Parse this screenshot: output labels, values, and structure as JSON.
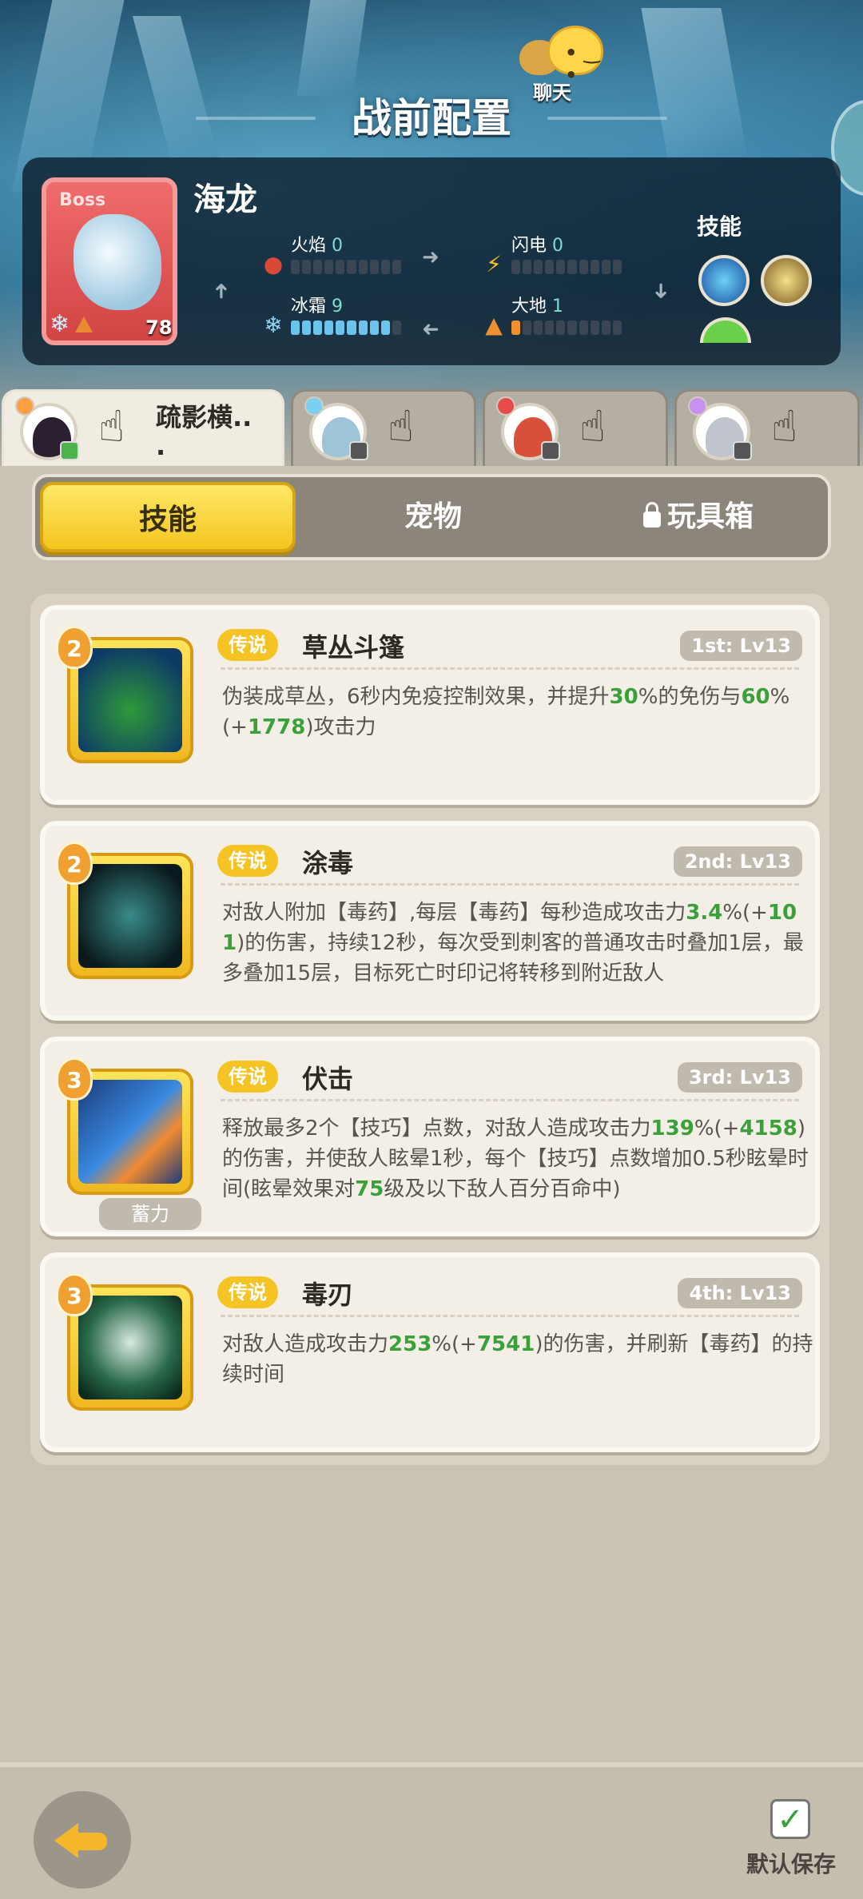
{
  "header": {
    "title": "战前配置",
    "chat_label": "聊天"
  },
  "boss": {
    "tag": "Boss",
    "name": "海龙",
    "level": "78",
    "elements": [
      {
        "label": "火焰",
        "value": "0",
        "filled": 0,
        "color": "#d84a36"
      },
      {
        "label": "闪电",
        "value": "0",
        "filled": 0,
        "color": "#f5c324"
      },
      {
        "label": "冰霜",
        "value": "9",
        "filled": 9,
        "color": "#6cc4ec"
      },
      {
        "label": "大地",
        "value": "1",
        "filled": 1,
        "color": "#f0902e"
      }
    ],
    "skills_label": "技能",
    "skill_icons": [
      "water-burst-icon",
      "sand-claw-icon",
      "green-slime-icon"
    ]
  },
  "characters": [
    {
      "name": "疏影横..",
      "extra": ".",
      "active": true
    },
    {
      "name": "",
      "active": false
    },
    {
      "name": "",
      "active": false
    },
    {
      "name": "",
      "active": false
    }
  ],
  "tabs": [
    {
      "label": "技能",
      "active": true
    },
    {
      "label": "宠物",
      "active": false
    },
    {
      "label": "玩具箱",
      "active": false,
      "locked": true
    }
  ],
  "skills": [
    {
      "rank": "2",
      "tag": "传说",
      "name": "草丛斗篷",
      "order": "1st: Lv13",
      "desc_parts": [
        {
          "t": "伪装成草丛，6秒内免疫控制效果，并提升"
        },
        {
          "t": "30",
          "g": true
        },
        {
          "t": "%的免伤与"
        },
        {
          "t": "60",
          "g": true
        },
        {
          "t": "%(+"
        },
        {
          "t": "1778",
          "g": true
        },
        {
          "t": ")攻击力"
        }
      ],
      "icon": "bush-cloak-icon",
      "charge": ""
    },
    {
      "rank": "2",
      "tag": "传说",
      "name": "涂毒",
      "order": "2nd: Lv13",
      "desc_parts": [
        {
          "t": "对敌人附加【毒药】,每层【毒药】每秒造成攻击力"
        },
        {
          "t": "3.4",
          "g": true
        },
        {
          "t": "%(+"
        },
        {
          "t": "101",
          "g": true
        },
        {
          "t": ")的伤害，持续12秒，每次受到刺客的普通攻击时叠加1层，最多叠加15层，目标死亡时印记将转移到附近敌人"
        }
      ],
      "icon": "poison-drop-icon",
      "charge": ""
    },
    {
      "rank": "3",
      "tag": "传说",
      "name": "伏击",
      "order": "3rd: Lv13",
      "desc_parts": [
        {
          "t": "释放最多2个【技巧】点数，对敌人造成攻击力"
        },
        {
          "t": "139",
          "g": true
        },
        {
          "t": "%(+"
        },
        {
          "t": "4158",
          "g": true
        },
        {
          "t": ")的伤害，并使敌人眩晕1秒，每个【技巧】点数增加0.5秒眩晕时间(眩晕效果对"
        },
        {
          "t": "75",
          "g": true
        },
        {
          "t": "级及以下敌人百分百命中)"
        }
      ],
      "icon": "ambush-strike-icon",
      "charge": "蓄力"
    },
    {
      "rank": "3",
      "tag": "传说",
      "name": "毒刃",
      "order": "4th: Lv13",
      "desc_parts": [
        {
          "t": "对敌人造成攻击力"
        },
        {
          "t": "253",
          "g": true
        },
        {
          "t": "%(+"
        },
        {
          "t": "7541",
          "g": true
        },
        {
          "t": ")的伤害，并刷新【毒药】的持续时间"
        }
      ],
      "icon": "poison-skull-icon",
      "charge": ""
    }
  ],
  "footer": {
    "save_label": "默认保存"
  }
}
